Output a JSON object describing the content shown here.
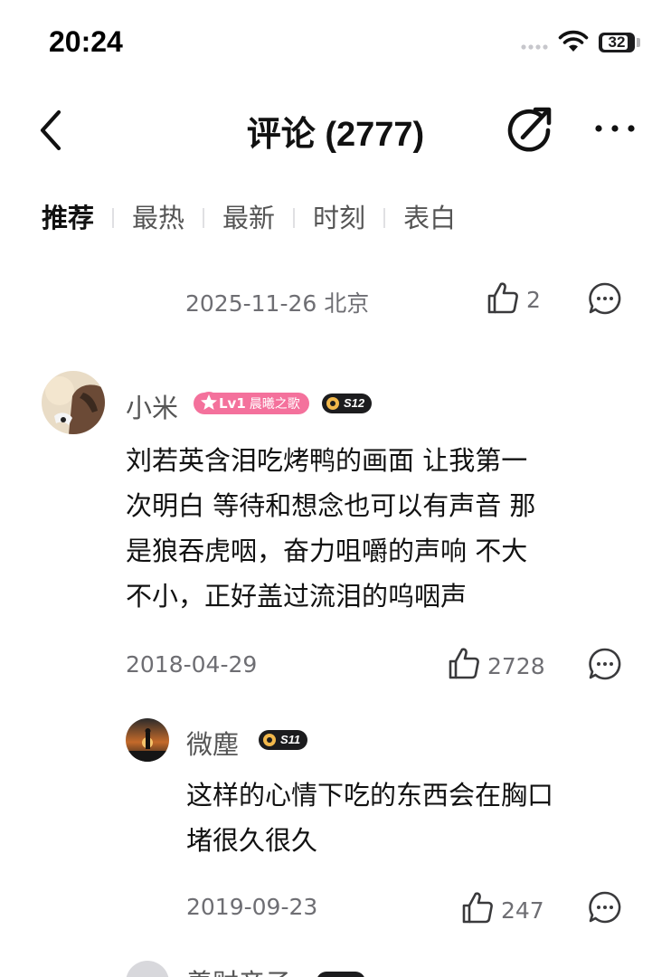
{
  "status_bar": {
    "time": "20:24",
    "battery": "32"
  },
  "nav": {
    "title": "评论 (2777)",
    "back_icon": "chevron-left-icon",
    "share_icon": "share-icon",
    "more_icon": "more-icon"
  },
  "tabs": [
    {
      "label": "推荐",
      "active": true
    },
    {
      "label": "最热",
      "active": false
    },
    {
      "label": "最新",
      "active": false
    },
    {
      "label": "时刻",
      "active": false
    },
    {
      "label": "表白",
      "active": false
    }
  ],
  "prev_comment": {
    "meta": "2025-11-26 北京",
    "likes": "2"
  },
  "comment": {
    "username": "小米",
    "level": "Lv1",
    "level_title": "晨曦之歌",
    "season_badge": "S12",
    "text_lines": [
      "刘若英含泪吃烤鸭的画面 让我第一",
      "次明白 等待和想念也可以有声音 那",
      "是狼吞虎咽，奋力咀嚼的声响 不大",
      "不小，正好盖过流泪的呜咽声"
    ],
    "date": "2018-04-29",
    "likes": "2728"
  },
  "reply": {
    "username": "微塵",
    "season_badge": "S11",
    "text_lines": [
      "这样的心情下吃的东西会在胸口",
      "堵很久很久"
    ],
    "date": "2019-09-23",
    "likes": "247"
  },
  "next_reply": {
    "username": "羡财帝子"
  },
  "colors": {
    "level_badge": "#f4719c",
    "text_primary": "#111111",
    "text_secondary": "#6e6e73"
  }
}
